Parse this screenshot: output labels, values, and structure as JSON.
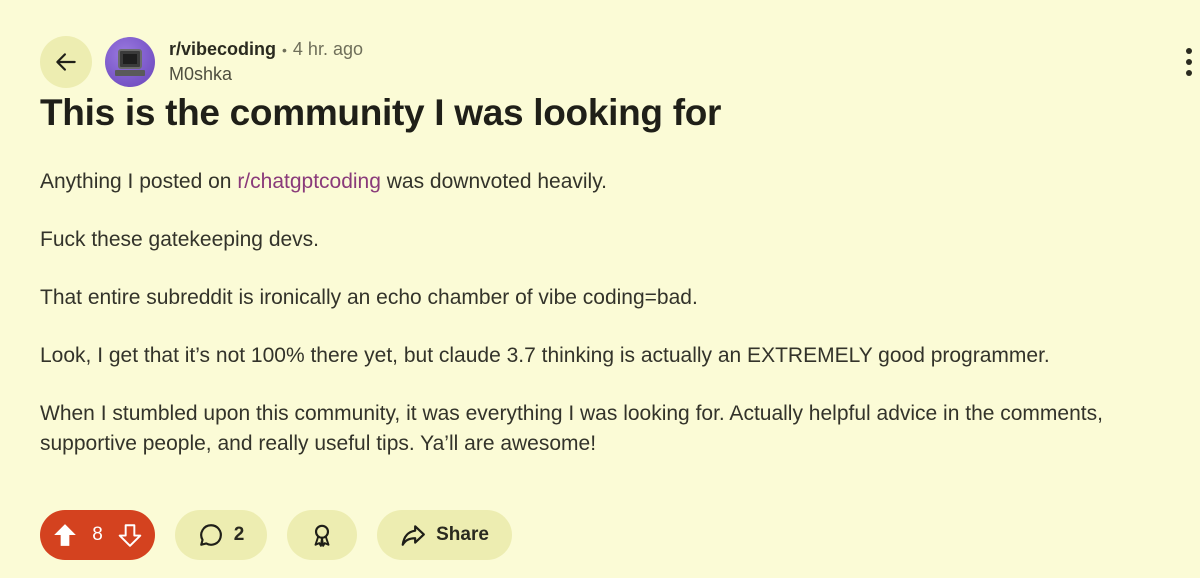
{
  "post": {
    "subreddit": "r/vibecoding",
    "separator": "•",
    "time": "4 hr. ago",
    "author": "M0shka",
    "title": "This is the community I was looking for",
    "body": {
      "p1_before": "Anything I posted on ",
      "p1_link": "r/chatgptcoding",
      "p1_after": " was downvoted heavily.",
      "p2": "Fuck these gatekeeping devs.",
      "p3": "That entire subreddit is ironically an echo chamber of vibe coding=bad.",
      "p4": "Look, I get that it’s not 100% there yet, but claude 3.7 thinking is actually an EXTREMELY good programmer.",
      "p5": "When I stumbled upon this community, it was everything I was looking for. Actually helpful advice in the comments, supportive people, and really useful tips. Ya’ll are awesome!"
    }
  },
  "actions": {
    "votes": "8",
    "comments": "2",
    "share_label": "Share"
  },
  "icons": {
    "back": "arrow-left-icon",
    "upvote": "upvote-arrow-icon",
    "downvote": "downvote-arrow-icon",
    "comment": "comment-bubble-icon",
    "award": "award-ribbon-icon",
    "share": "share-arrow-icon",
    "more": "vertical-dots-icon"
  },
  "colors": {
    "background": "#fbfbd6",
    "pill": "#ededb1",
    "vote_active": "#d4421f",
    "link": "#8a3a7a"
  }
}
